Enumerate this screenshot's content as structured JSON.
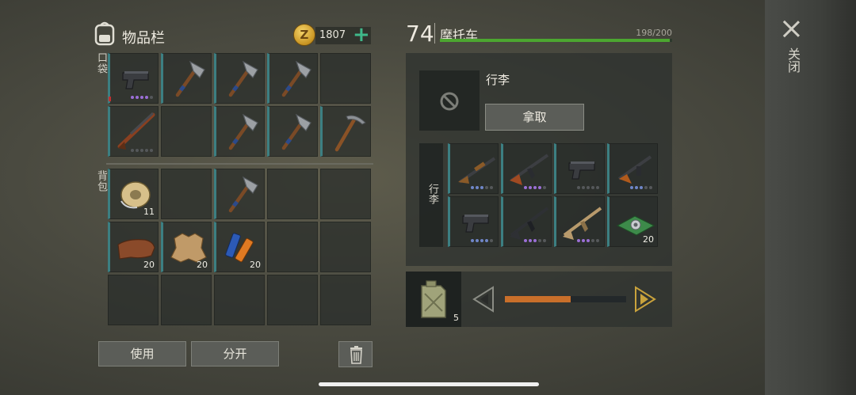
{
  "inventory": {
    "title": "物品栏",
    "coins": "1807",
    "coin_symbol": "Z",
    "pocket_label": "口袋",
    "backpack_label": "背包",
    "pocket_slots": [
      {
        "icon": "pistol-icon",
        "durability": 4,
        "dot_color": "#9b6fd6",
        "count": ""
      },
      {
        "icon": "hatchet-icon",
        "durability": 0,
        "dot_color": "",
        "count": ""
      },
      {
        "icon": "hatchet-icon",
        "durability": 0,
        "dot_color": "",
        "count": ""
      },
      {
        "icon": "hatchet-icon",
        "durability": 0,
        "dot_color": "",
        "count": ""
      },
      {
        "icon": "",
        "durability": 0,
        "dot_color": "",
        "count": ""
      },
      {
        "icon": "shotgun-icon",
        "durability": 0,
        "dot_color": "",
        "count": ""
      },
      {
        "icon": "",
        "durability": 0,
        "dot_color": "",
        "count": ""
      },
      {
        "icon": "hatchet-icon",
        "durability": 0,
        "dot_color": "",
        "count": ""
      },
      {
        "icon": "hatchet-icon",
        "durability": 0,
        "dot_color": "",
        "count": ""
      },
      {
        "icon": "pickaxe-icon",
        "durability": 0,
        "dot_color": "",
        "count": ""
      }
    ],
    "backpack_slots": [
      {
        "icon": "wire-spool-icon",
        "count": "11"
      },
      {
        "icon": "",
        "count": ""
      },
      {
        "icon": "hatchet-icon",
        "count": ""
      },
      {
        "icon": "",
        "count": ""
      },
      {
        "icon": "",
        "count": ""
      },
      {
        "icon": "leather-icon",
        "count": "20"
      },
      {
        "icon": "hide-icon",
        "count": "20"
      },
      {
        "icon": "batteries-icon",
        "count": "20"
      },
      {
        "icon": "",
        "count": ""
      },
      {
        "icon": "",
        "count": ""
      },
      {
        "icon": "",
        "count": ""
      },
      {
        "icon": "",
        "count": ""
      },
      {
        "icon": "",
        "count": ""
      },
      {
        "icon": "",
        "count": ""
      },
      {
        "icon": "",
        "count": ""
      }
    ],
    "use_label": "使用",
    "split_label": "分开"
  },
  "vehicle": {
    "level": "74",
    "name": "摩托车",
    "hp_text": "198/200",
    "hp_fraction": 0.99,
    "cargo_title": "行李",
    "take_label": "拿取",
    "cargo_side_label": "行李",
    "cargo_slots": [
      {
        "icon": "shotgun-pump-icon",
        "count": ""
      },
      {
        "icon": "ak-rifle-icon",
        "count": ""
      },
      {
        "icon": "pistol-icon",
        "count": ""
      },
      {
        "icon": "smg-icon",
        "count": ""
      },
      {
        "icon": "pistol-icon",
        "count": ""
      },
      {
        "icon": "assault-rifle-icon",
        "count": ""
      },
      {
        "icon": "tan-rifle-icon",
        "count": ""
      },
      {
        "icon": "circuit-board-icon",
        "count": "20"
      }
    ],
    "fuel_count": "5",
    "fuel_fraction": 0.54
  },
  "close_label": "关闭",
  "colors": {
    "accent_green": "#3fb88a",
    "hp_green": "#4ca630",
    "fuel_orange": "#c96f2a",
    "rarity_purple": "#9b6fd6"
  }
}
